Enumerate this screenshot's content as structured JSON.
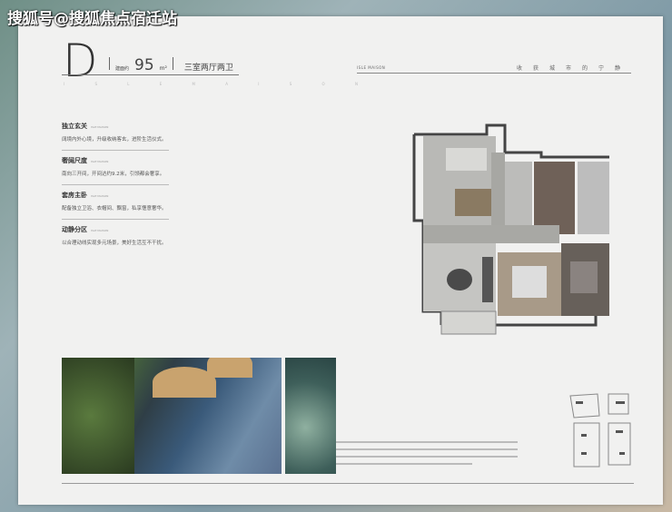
{
  "watermark": "搜狐号@搜狐焦点宿迁站",
  "unit": {
    "letter": "D",
    "area_label": "建面约",
    "area": "95",
    "area_unit": "m²",
    "layout": "三室两厅两卫",
    "spaced": "I S L E M A I S O N"
  },
  "features": [
    {
      "title": "独立玄关",
      "sub": "ISLE MAISON",
      "desc": "阔境内外心境，升级收纳客玄，进阶生活仪式。"
    },
    {
      "title": "奢阔尺度",
      "sub": "ISLE MAISON",
      "desc": "南向三开间，开间达约9.2米，引领都会奢享。"
    },
    {
      "title": "套房主卧",
      "sub": "ISLE MAISON",
      "desc": "配备独立卫浴、衣帽间、飘窗，私享惬意奢华。"
    },
    {
      "title": "动静分区",
      "sub": "ISLE MAISON",
      "desc": "以合理动线实现多元场景，美好生活互不干扰。"
    }
  ],
  "right_header": {
    "brand": "ISLE MAISON",
    "slogan": "收获城市的宁静"
  }
}
